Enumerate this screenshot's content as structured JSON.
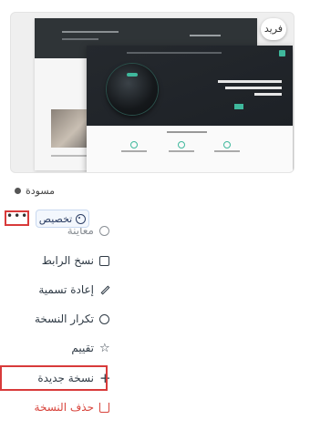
{
  "theme_card": {
    "badge": "فريد"
  },
  "status": {
    "label": "مسودة"
  },
  "actions": {
    "more_label": "•••",
    "customize_label": "تخصيص"
  },
  "menu": {
    "items": [
      {
        "label": "معاينة",
        "icon": "eye-icon"
      },
      {
        "label": "نسخ الرابط",
        "icon": "copy-link-icon"
      },
      {
        "label": "إعادة تسمية",
        "icon": "pencil-icon"
      },
      {
        "label": "تكرار النسخة",
        "icon": "duplicate-icon"
      },
      {
        "label": "تقييم",
        "icon": "star-icon"
      },
      {
        "label": "نسخة جديدة",
        "icon": "plus-icon"
      },
      {
        "label": "حذف النسخة",
        "icon": "trash-icon"
      }
    ]
  },
  "colors": {
    "highlight": "#d83a3a",
    "danger_text": "#d8443c",
    "accent": "#3fb89c"
  }
}
